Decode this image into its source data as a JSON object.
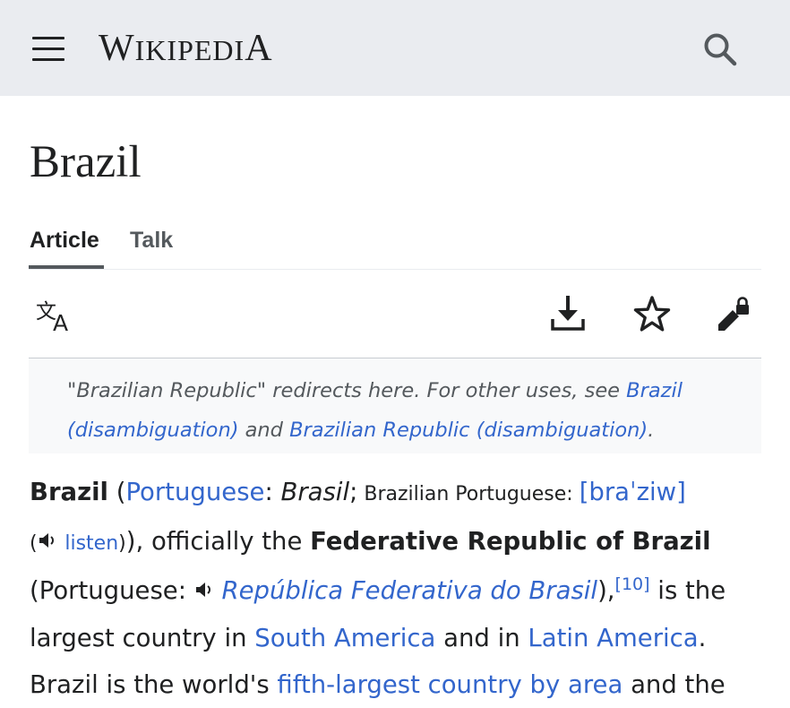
{
  "header": {
    "menu_icon": "hamburger-menu-icon",
    "wordmark_cap1": "W",
    "wordmark_mid": "IKIPEDI",
    "wordmark_cap2": "A",
    "search_icon": "search-icon"
  },
  "page": {
    "title": "Brazil",
    "tabs": [
      {
        "label": "Article",
        "active": true
      },
      {
        "label": "Talk",
        "active": false
      }
    ]
  },
  "toolbar": {
    "language_icon": "language-icon",
    "download_icon": "download-icon",
    "watch_icon": "star-icon",
    "edit_icon": "edit-locked-icon"
  },
  "hatnote": {
    "t1": "\"Brazilian Republic\" redirects here. For other uses, see ",
    "link1": "Brazil (disambiguation)",
    "t2": " and ",
    "link2": "Brazilian Republic (disambiguation)",
    "t3": "."
  },
  "article": {
    "s1": "Brazil",
    "s2": " (",
    "link_portuguese": "Portuguese",
    "s3": ": ",
    "s4_italic": "Brasil",
    "s5": ";",
    "s6_small": " Brazilian Portuguese: ",
    "link_ipa": "[braˈziw]",
    "s7_small": "(",
    "link_listen": "listen",
    "s8_small": ")",
    "s9": "), officially the ",
    "s10_bold": "Federative Republic of Brazil",
    "s11": " (Portuguese: ",
    "link_republica": "República Federativa do Brasil",
    "s12": "),",
    "ref": "[10]",
    "s13": " is the largest country in ",
    "link_south_america": "South America",
    "s14": " and in ",
    "link_latin_america": "Latin America",
    "s15": ". Brazil is the world's ",
    "link_fifth": "fifth-largest country by area",
    "s16": " and the"
  }
}
